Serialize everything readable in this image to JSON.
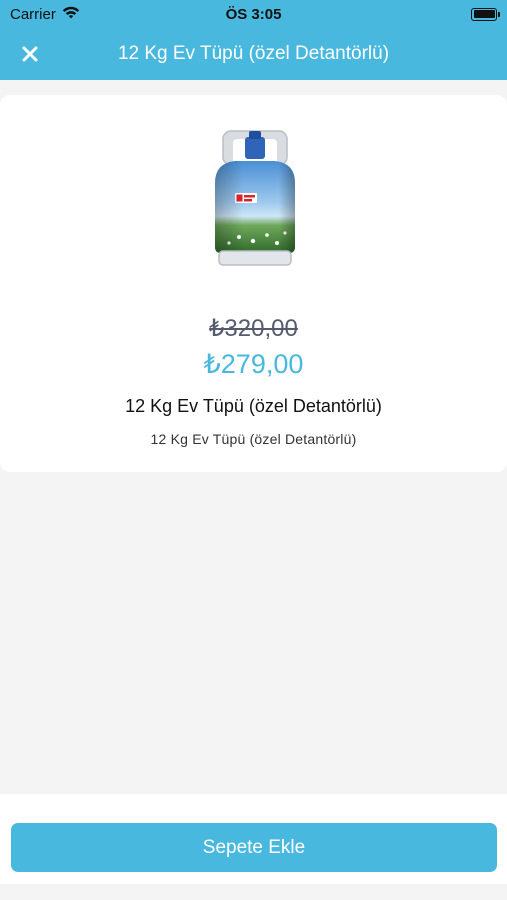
{
  "status_bar": {
    "carrier": "Carrier",
    "time": "ÖS 3:05",
    "wifi_icon": "wifi-icon",
    "battery_icon": "battery-icon"
  },
  "nav": {
    "close_icon": "close-icon",
    "title": "12 Kg Ev Tüpü (özel Detantörlü)"
  },
  "product": {
    "image": "gas-cylinder-image",
    "old_price": "₺320,00",
    "new_price": "₺279,00",
    "title": "12 Kg Ev Tüpü (özel Detantörlü)",
    "description": "12 Kg Ev Tüpü (özel Detantörlü)"
  },
  "actions": {
    "add_to_cart_label": "Sepete Ekle"
  },
  "colors": {
    "accent": "#48b8de",
    "old_price": "#555b6e"
  }
}
